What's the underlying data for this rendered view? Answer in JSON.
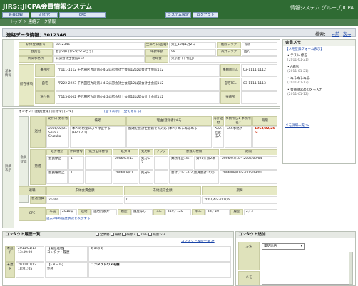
{
  "header": {
    "app_title": "JIRS::JICPA会員情報システム",
    "system_title": "情報システム グループJICPA",
    "nav": [
      "会員登録",
      "研修 它",
      "CPE",
      "システム設定",
      "ログアウト"
    ]
  },
  "breadcrumb": "トップ ＞ 連絡データ情報",
  "page": {
    "title": "連絡データ情報：3012346",
    "search_label": "検索：",
    "prev": "←前",
    "next": "次→"
  },
  "basic": {
    "side": "基本情報",
    "rows": [
      {
        "l1": "研修登録番号",
        "v1": "3012346",
        "l2": "生年月日/国籍年月",
        "v2": "大正10年1月2日",
        "l3": "削除フラグ",
        "v3": "有効"
      },
      {
        "l1": "会員名",
        "v1": "会計2郎 (かいけい 2ろう)",
        "l2": "年齢年齢",
        "v2": "90",
        "l3": "海外フラグ",
        "v3": "国内"
      },
      {
        "l1": "所属事務所",
        "v1": "公認会計士会館112",
        "l2": "地域会",
        "v2": "東京会 (千代田)"
      }
    ],
    "office": {
      "side": "所在事項",
      "rows": [
        {
          "l": "事務所",
          "v": "〒111-1112 千代田区九段南4-4-2公認会計士会館12公認会計士会館112",
          "tl": "事務所TEL",
          "tv": "03-1111-1112"
        },
        {
          "l": "自宅",
          "v": "〒222-2223 千代田区九段南4-4-2公認会計士会館12公認会計士会館112",
          "tl": "自宅TEL",
          "tv": "03-1111-1113"
        },
        {
          "l": "送付先",
          "v": "〒113-0002 千代田区九段南4-4-2公認会計士会館12公認会計士会館112",
          "tl": "事務所",
          "tv": ""
        }
      ]
    }
  },
  "detail": {
    "side": "詳細表示",
    "toolbar": "オンオフ：[会員登録] [研修令] [CPE]",
    "toolbar_links": [
      "[全て表示]",
      "[全て閉じる]"
    ],
    "sub": {
      "side": "会員登録",
      "send": {
        "label": "送付",
        "head": [
          "受付日 更新者",
          "備考",
          "理由(登録者)メモ",
          "海外送付",
          "事務所名1 事務所名2",
          "期限"
        ],
        "row": [
          "2008/02/01 Satou Shizuko",
          "本人の希望により停止する (H20.2.1)",
          "配達を会計士会館での対応 (本人) ぬるぬるぬる",
          "AAA監査法人",
          "SSS事務所",
          "1963/02/25 〜"
        ]
      },
      "stop": {
        "label": "懲戒",
        "head": [
          "処分種別",
          "件目番号",
          "処分全体番号",
          "処分日",
          "処分日",
          "フラグ",
          "懲戒の種類",
          "期間"
        ],
        "rows": [
          [
            "会員停止",
            "1",
            "",
            "2006/07/13",
            "処分日 2",
            "",
            " 業務停止1年",
            "第91条第2項",
            "2006/07/18〜2006/09/04"
          ],
          [
            "会員権停止",
            "1",
            "",
            "2006/08/01",
            "処分日 ",
            "",
            " 会計(21-1-2-2(会員会計2の))",
            "",
            "2006/08/01〜2006/09/01"
          ]
        ]
      },
      "reg": {
        "label": "退職",
        "head": [
          "未納会費金額",
          "未納延滞金額",
          "期間"
        ]
      },
      "fee": {
        "label": "普通会費",
        "row": [
          "25000",
          "0",
          "2007/4〜2007/6"
        ]
      }
    },
    "cpe": {
      "label": "CPE",
      "row": [
        "年度",
        "2010年",
        "連絡",
        "連絡対象外",
        "履歴",
        "履歴なし",
        "3年",
        "249／120",
        "単年",
        "28／20",
        "履歴",
        "2／2"
      ],
      "link": "過去3年の履歴状況を表示する"
    }
  },
  "memo": {
    "title": "会員メモ",
    "sub": "【メモ登録フォーム表示】",
    "items": [
      {
        "t": "テスト 修正",
        "d": "(2011-01-21)"
      },
      {
        "t": "A病気",
        "d": "(2011-01-21)"
      },
      {
        "t": "ぬるぬるぬる",
        "d": "(2011-01-13)"
      },
      {
        "t": "会員請求めのメモ入力",
        "d": "(2011-01-12)"
      }
    ],
    "list_link": "メモ詳細一覧 ≫"
  },
  "contact": {
    "title": "コンタクト履歴一覧",
    "filters": [
      "全業務",
      "研修",
      "研修 4",
      "CPE",
      "照会シス"
    ],
    "history_link": "コンタクト履歴一覧 ≫",
    "rows": [
      {
        "status": "未遅択",
        "date": "2011/01/13 13:49:00",
        "type": "【電話連絡】",
        "sub": "コンタクト履歴",
        "memo": "ああああ"
      },
      {
        "status": "未遅択",
        "date": "2011/01/12 18:01:05",
        "type": "【Eメール】",
        "sub": "外務",
        "memo": "コンタクトのメモ欄"
      }
    ]
  },
  "contact_add": {
    "title": "コンタクト追加",
    "method_label": "方法",
    "method_value": "電話連絡",
    "memo_label": "メモ"
  }
}
